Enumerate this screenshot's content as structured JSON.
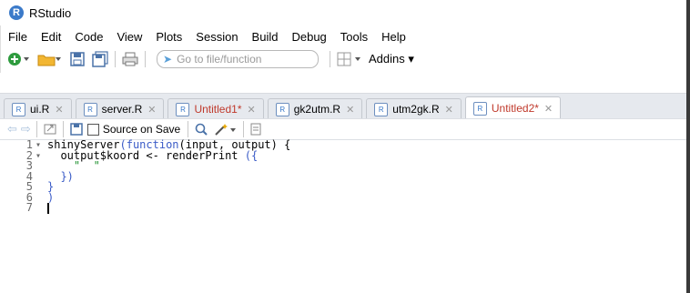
{
  "window": {
    "title": "RStudio",
    "logo_letter": "R"
  },
  "menu": [
    "File",
    "Edit",
    "Code",
    "View",
    "Plots",
    "Session",
    "Build",
    "Debug",
    "Tools",
    "Help"
  ],
  "toolbar": {
    "goto_placeholder": "Go to file/function",
    "addins_label": "Addins ▾"
  },
  "tabs": [
    {
      "label": "ui.R",
      "unsaved": false,
      "active": false
    },
    {
      "label": "server.R",
      "unsaved": false,
      "active": false
    },
    {
      "label": "Untitled1*",
      "unsaved": true,
      "active": false
    },
    {
      "label": "gk2utm.R",
      "unsaved": false,
      "active": false
    },
    {
      "label": "utm2gk.R",
      "unsaved": false,
      "active": false
    },
    {
      "label": "Untitled2*",
      "unsaved": true,
      "active": true
    }
  ],
  "editor_toolbar": {
    "source_on_save": "Source on Save"
  },
  "code": {
    "line_numbers": [
      "1",
      "2",
      "3",
      "4",
      "5",
      "6",
      "7"
    ],
    "l1_pre": "shinyServer",
    "l1_paren": "(",
    "l1_kw": "function",
    "l1_args": "(input, output) {",
    "l2_pre": "output$koord <- renderPrint ",
    "l2_paren": "({",
    "l3": "\"  \"",
    "l4": "})",
    "l5": "}",
    "l6": ")"
  },
  "colors": {
    "keyword": "#3a5bc7",
    "string": "#1a8f2b",
    "unsaved_tab": "#c0392b"
  }
}
